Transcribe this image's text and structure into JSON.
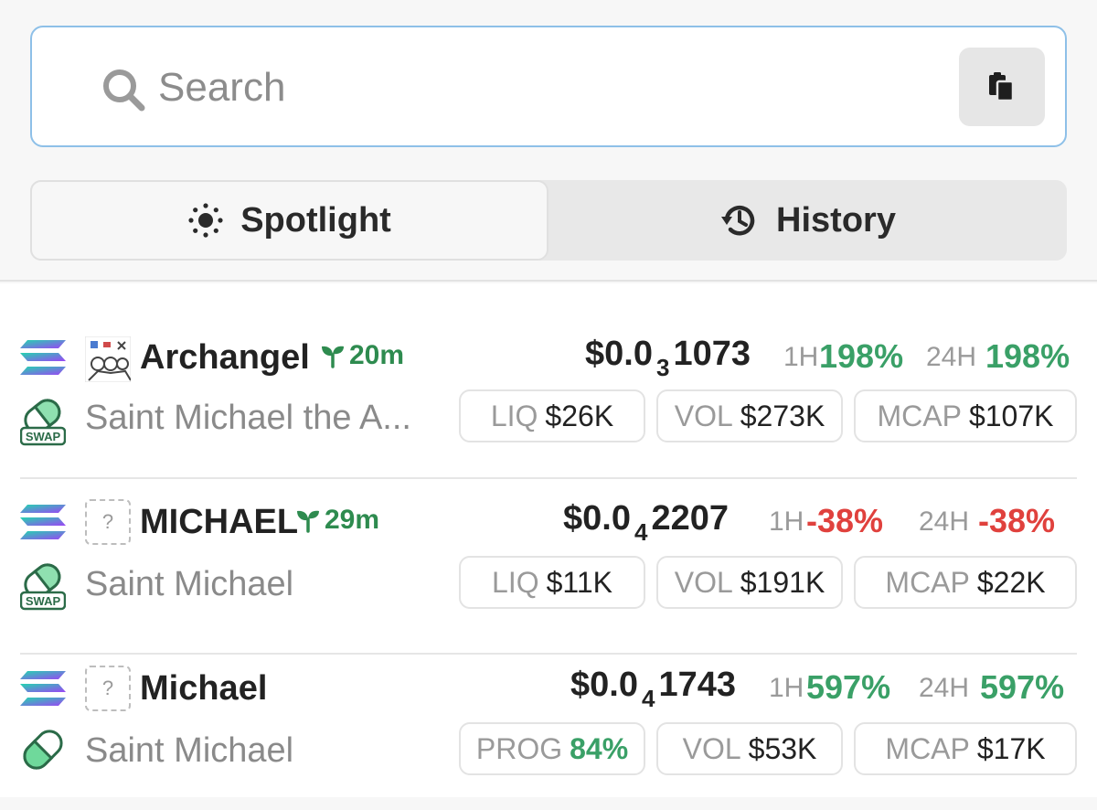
{
  "search": {
    "placeholder": "Search"
  },
  "tabs": [
    {
      "label": "Spotlight",
      "icon": "sun-icon",
      "active": true
    },
    {
      "label": "History",
      "icon": "history-icon",
      "active": false
    }
  ],
  "colors": {
    "accent_green": "#3aa067",
    "negative_red": "#e0413d",
    "search_border": "#8ec0e8"
  },
  "tokens": [
    {
      "ticker": "Archangel",
      "age": "20m",
      "name": "Saint Michael the A...",
      "price_prefix": "$0.0",
      "price_zeros": "3",
      "price_digits": "1073",
      "h1_label": "1H",
      "h1": "198%",
      "h1_dir": "up",
      "h24_label": "24H",
      "h24": "198%",
      "h24_dir": "up",
      "stats": [
        {
          "label": "LIQ",
          "value": "$26K"
        },
        {
          "label": "VOL",
          "value": "$273K"
        },
        {
          "label": "MCAP",
          "value": "$107K"
        }
      ],
      "dex_icon": "swap-pill-icon",
      "chain_icon": "solana-icon",
      "image": "token-image-icon"
    },
    {
      "ticker": "MICHAEL",
      "age": "29m",
      "name": "Saint Michael",
      "price_prefix": "$0.0",
      "price_zeros": "4",
      "price_digits": "2207",
      "h1_label": "1H",
      "h1": "-38%",
      "h1_dir": "down",
      "h24_label": "24H",
      "h24": "-38%",
      "h24_dir": "down",
      "stats": [
        {
          "label": "LIQ",
          "value": "$11K"
        },
        {
          "label": "VOL",
          "value": "$191K"
        },
        {
          "label": "MCAP",
          "value": "$22K"
        }
      ],
      "dex_icon": "swap-pill-icon",
      "chain_icon": "solana-icon",
      "image": "unknown-image-icon"
    },
    {
      "ticker": "Michael",
      "age": "",
      "name": "Saint Michael",
      "price_prefix": "$0.0",
      "price_zeros": "4",
      "price_digits": "1743",
      "h1_label": "1H",
      "h1": "597%",
      "h1_dir": "up",
      "h24_label": "24H",
      "h24": "597%",
      "h24_dir": "up",
      "stats": [
        {
          "label": "PROG",
          "value": "84%"
        },
        {
          "label": "VOL",
          "value": "$53K"
        },
        {
          "label": "MCAP",
          "value": "$17K"
        }
      ],
      "dex_icon": "pill-icon",
      "chain_icon": "solana-icon",
      "image": "unknown-image-icon"
    }
  ],
  "unknown_image_glyph": "?"
}
